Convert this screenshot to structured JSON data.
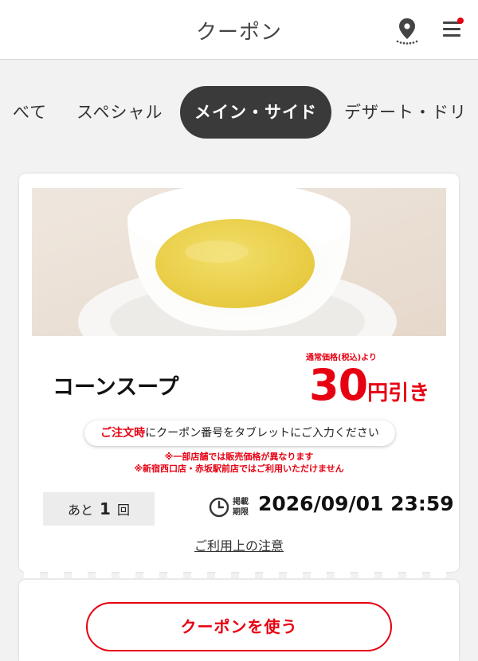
{
  "header": {
    "title": "クーポン",
    "icons": [
      "location-pin-icon",
      "menu-icon"
    ],
    "badge_color": "#e60012"
  },
  "tabs": [
    {
      "label": "べて",
      "active": false
    },
    {
      "label": "スペシャル",
      "active": false
    },
    {
      "label": "メイン・サイド",
      "active": true
    },
    {
      "label": "デザート・ドリ",
      "active": false
    }
  ],
  "coupon": {
    "name": "コーンスープ",
    "price_note": "通常価格(税込)より",
    "discount_value": "30",
    "discount_unit": "円引き",
    "instruction_emphasis": "ご注文時",
    "instruction_rest": "にクーポン番号をタブレットにご入力ください",
    "note1": "※一部店舗では販売価格が異なります",
    "note2": "※新宿西口店・赤坂駅前店ではご利用いただけません",
    "remaining_prefix": "あと",
    "remaining_count": "1",
    "remaining_suffix": "回",
    "expiry_label_line1": "掲載",
    "expiry_label_line2": "期限",
    "expiry_date": "2026/09/01 23:59",
    "terms_link": "ご利用上の注意"
  },
  "actions": {
    "use_button": "クーポンを使う"
  },
  "colors": {
    "accent": "#e60012",
    "active_tab": "#3a3a3a"
  }
}
